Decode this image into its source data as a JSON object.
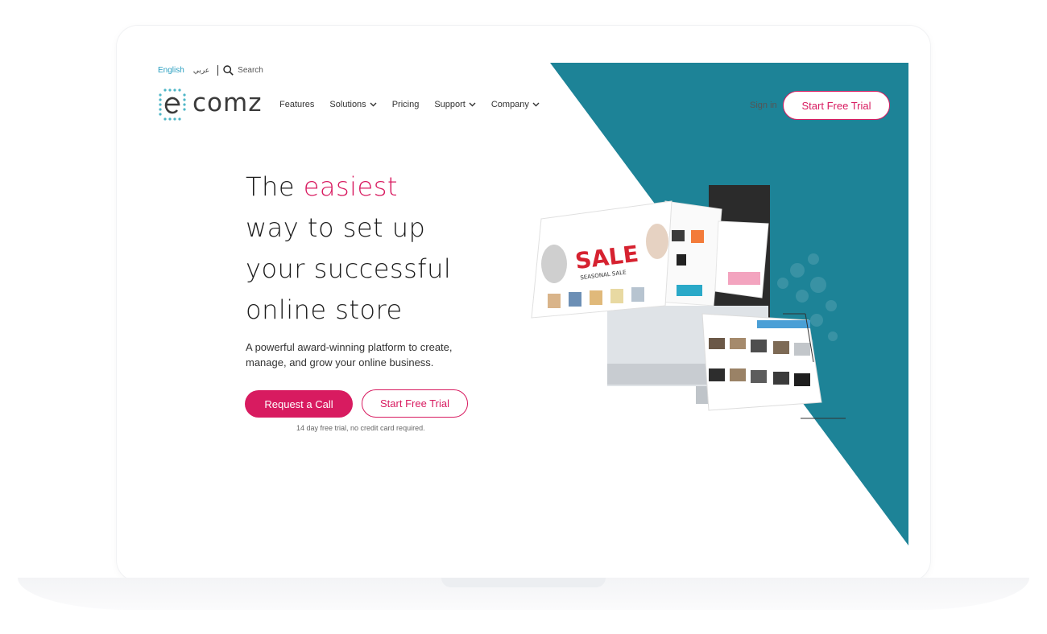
{
  "colors": {
    "accent": "#d81b60",
    "teal": "#1d8397",
    "lang_active": "#2a9fc0"
  },
  "utility": {
    "lang_english": "English",
    "lang_arabic": "عربي",
    "search_label": "Search"
  },
  "brand": {
    "logo_rest": "comz"
  },
  "nav": {
    "items": [
      {
        "label": "Features",
        "dropdown": false
      },
      {
        "label": "Solutions",
        "dropdown": true
      },
      {
        "label": "Pricing",
        "dropdown": false
      },
      {
        "label": "Support",
        "dropdown": true
      },
      {
        "label": "Company",
        "dropdown": true
      }
    ],
    "signin": "Sign in",
    "cta": "Start Free Trial"
  },
  "hero": {
    "line1_prefix": "The ",
    "line1_accent": "easiest",
    "line2": "way to set up",
    "line3": "your successful",
    "line4": "online store",
    "subtitle": "A powerful award-winning platform to create, manage, and grow your online business.",
    "primary_button": "Request a Call",
    "secondary_button": "Start Free Trial",
    "note": "14 day free trial, no credit card required."
  },
  "mockup": {
    "sale_text": "SALE",
    "sale_sub": "SEASONAL SALE"
  },
  "icons": {
    "search": "search-icon",
    "chevron": "chevron-down-icon",
    "logo": "ecomz-logo"
  }
}
